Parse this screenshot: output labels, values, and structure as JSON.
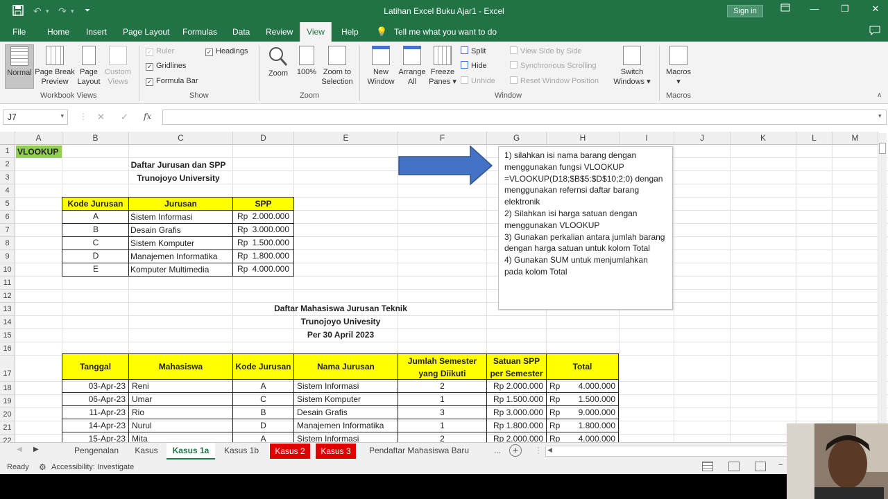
{
  "window": {
    "title": "Latihan Excel Buku Ajar1  -  Excel",
    "sign_in": "Sign in"
  },
  "menu": {
    "file": "File",
    "tabs": [
      "Home",
      "Insert",
      "Page Layout",
      "Formulas",
      "Data",
      "Review",
      "View",
      "Help"
    ],
    "active_tab": "View",
    "tell_me": "Tell me what you want to do"
  },
  "ribbon": {
    "workbook_views": {
      "label": "Workbook Views",
      "normal": "Normal",
      "page_break_1": "Page Break",
      "page_break_2": "Preview",
      "page_layout_1": "Page",
      "page_layout_2": "Layout",
      "custom_1": "Custom",
      "custom_2": "Views"
    },
    "show": {
      "label": "Show",
      "ruler": "Ruler",
      "gridlines": "Gridlines",
      "formula_bar": "Formula Bar",
      "headings": "Headings"
    },
    "zoom": {
      "label": "Zoom",
      "zoom": "Zoom",
      "hundred": "100%",
      "sel_1": "Zoom to",
      "sel_2": "Selection"
    },
    "window": {
      "label": "Window",
      "new_1": "New",
      "new_2": "Window",
      "arrange_1": "Arrange",
      "arrange_2": "All",
      "freeze_1": "Freeze",
      "freeze_2": "Panes",
      "split": "Split",
      "hide": "Hide",
      "unhide": "Unhide",
      "side_by_side": "View Side by Side",
      "sync_scroll": "Synchronous Scrolling",
      "reset_pos": "Reset Window Position",
      "switch_1": "Switch",
      "switch_2": "Windows"
    },
    "macros": {
      "label": "Macros",
      "macros": "Macros"
    }
  },
  "formula_bar": {
    "name_box": "J7",
    "fx": "fx",
    "content": ""
  },
  "columns": [
    "A",
    "B",
    "C",
    "D",
    "E",
    "F",
    "G",
    "H",
    "I",
    "J",
    "K",
    "L",
    "M"
  ],
  "rows": [
    "1",
    "2",
    "3",
    "4",
    "5",
    "6",
    "7",
    "8",
    "9",
    "10",
    "11",
    "12",
    "13",
    "14",
    "15",
    "16",
    "17",
    "18",
    "19",
    "20",
    "21",
    "22"
  ],
  "sheet": {
    "a1": "VLOOKUP",
    "title1": "Daftar Jurusan dan SPP",
    "title2": "Trunojoyo University",
    "table1_headers": [
      "Kode Jurusan",
      "Jurusan",
      "SPP"
    ],
    "table1_rows": [
      [
        "A",
        "Sistem Informasi",
        "Rp",
        "2.000.000"
      ],
      [
        "B",
        "Desain Grafis",
        "Rp",
        "3.000.000"
      ],
      [
        "C",
        "Sistem Komputer",
        "Rp",
        "1.500.000"
      ],
      [
        "D",
        "Manajemen Informatika",
        "Rp",
        "1.800.000"
      ],
      [
        "E",
        "Komputer Multimedia",
        "Rp",
        "4.000.000"
      ]
    ],
    "title3": "Daftar Mahasiswa Jurusan Teknik",
    "title4": "Trunojoyo Univesity",
    "title5": "Per 30 April 2023",
    "table2_headers": [
      "Tanggal",
      "Mahasiswa",
      "Kode Jurusan",
      "Nama Jurusan",
      "Jumlah Semester",
      "yang Diikuti",
      "Satuan SPP",
      "per Semester",
      "Total"
    ],
    "table2_rows": [
      [
        "03-Apr-23",
        "Reni",
        "A",
        "Sistem Informasi",
        "2",
        "Rp 2.000.000",
        "Rp",
        "4.000.000"
      ],
      [
        "06-Apr-23",
        "Umar",
        "C",
        "Sistem Komputer",
        "1",
        "Rp 1.500.000",
        "Rp",
        "1.500.000"
      ],
      [
        "11-Apr-23",
        "Rio",
        "B",
        "Desain Grafis",
        "3",
        "Rp 3.000.000",
        "Rp",
        "9.000.000"
      ],
      [
        "14-Apr-23",
        "Nurul",
        "D",
        "Manajemen Informatika",
        "1",
        "Rp 1.800.000",
        "Rp",
        "1.800.000"
      ],
      [
        "15-Apr-23",
        "Mita",
        "A",
        "Sistem Informasi",
        "2",
        "Rp 2.000.000",
        "Rp",
        "4.000.000"
      ]
    ],
    "note": "1) silahkan isi nama barang dengan menggunakan fungsi VLOOKUP =VLOOKUP(D18;$B$5:$D$10;2;0) dengan menggunakan refernsi daftar barang elektronik\n2) Silahkan isi harga satuan dengan menggunakan VLOOKUP\n3) Gunakan perkalian antara jumlah barang dengan harga satuan untuk kolom Total\n4) Gunakan SUM untuk menjumlahkan pada kolom Total"
  },
  "sheet_tabs": {
    "tabs": [
      "Pengenalan",
      "Kasus",
      "Kasus 1a",
      "Kasus 1b",
      "Kasus 2",
      "Kasus 3",
      "Pendaftar Mahasiswa Baru"
    ],
    "active": "Kasus 1a",
    "more": "..."
  },
  "status": {
    "ready": "Ready",
    "accessibility": "Accessibility: Investigate"
  },
  "colors": {
    "excel_green": "#217346",
    "header_yellow": "#ffff00",
    "arrow_blue": "#4472c4",
    "tab_red": "#e00000"
  }
}
